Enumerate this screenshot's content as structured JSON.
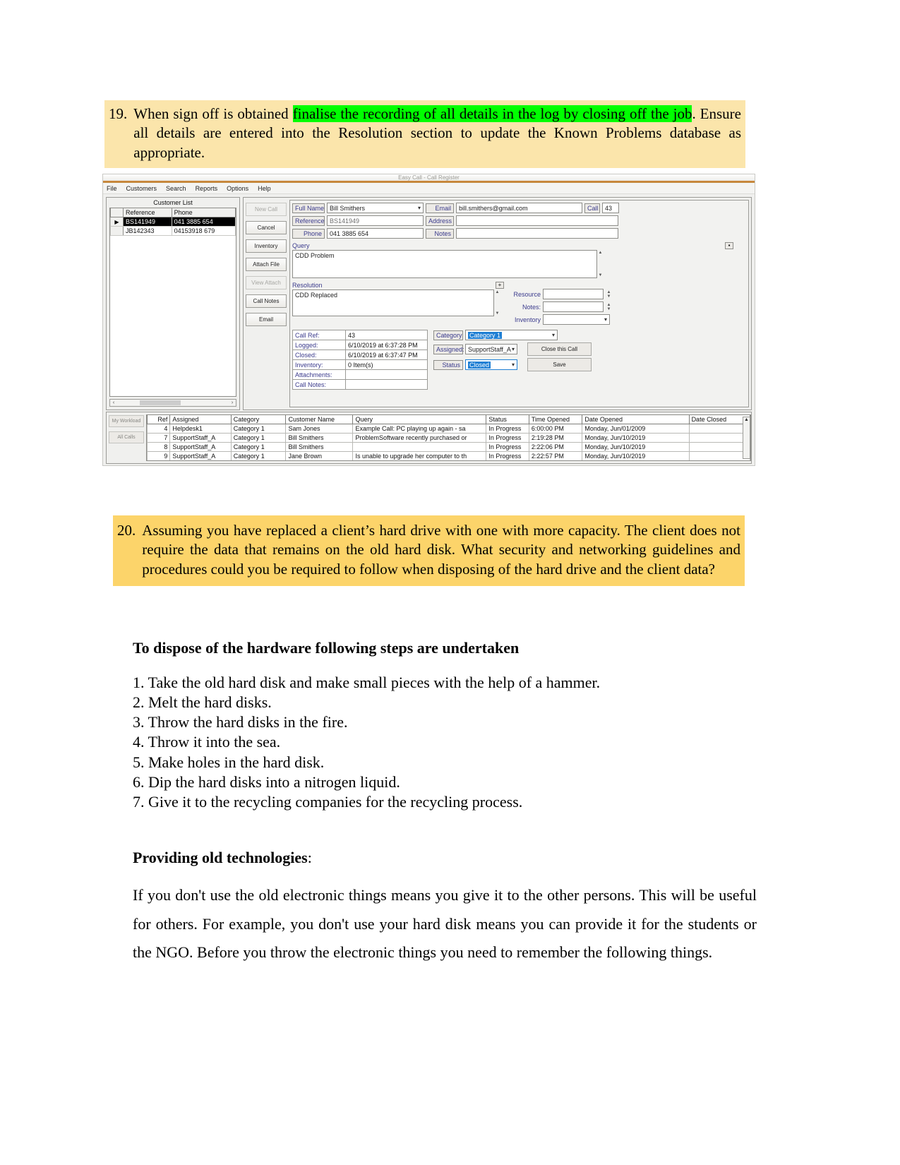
{
  "questions": [
    {
      "number": "19.",
      "text_before": "When sign off is obtained ",
      "highlight": "finalise the recording of all details in the log by closing off the job",
      "text_after": ". Ensure all details are entered into the Resolution section to update the Known Problems database as appropriate."
    },
    {
      "number": "20.",
      "text": "Assuming you have replaced a client’s hard drive with one with more capacity. The client does not require the data that remains on the old hard disk. What security and networking guidelines and procedures could you be required to follow when disposing of the hard drive and the client data?"
    }
  ],
  "app": {
    "title": "Easy Call - Call Register",
    "menu": [
      "File",
      "Customers",
      "Search",
      "Reports",
      "Options",
      "Help"
    ],
    "customer_panel": {
      "title": "Customer List",
      "columns": [
        "Reference",
        "Phone"
      ],
      "rows": [
        {
          "marker": "▶",
          "reference": "BS141949",
          "phone": "041 3885 654",
          "selected": true
        },
        {
          "marker": "",
          "reference": "JB142343",
          "phone": "04153918 679",
          "selected": false
        }
      ],
      "scroll_left": "‹",
      "scroll_right": "›"
    },
    "actions": [
      {
        "label": "New Call",
        "disabled": true
      },
      {
        "label": "Cancel",
        "disabled": false
      },
      {
        "label": "Inventory",
        "disabled": false
      },
      {
        "label": "Attach File",
        "disabled": false
      },
      {
        "label": "View Attach",
        "disabled": true
      },
      {
        "label": "Call Notes",
        "disabled": false
      },
      {
        "label": "Email",
        "disabled": false
      }
    ],
    "form": {
      "full_name_label": "Full Name",
      "full_name_value": "Bill Smithers",
      "reference_label": "Reference",
      "reference_value": "BS141949",
      "phone_label": "Phone",
      "phone_value": "041 3885 654",
      "email_label": "Email",
      "email_value": "bill.smithers@gmail.com",
      "address_label": "Address",
      "address_value": "",
      "notes_label": "Notes",
      "notes_value": "",
      "call_label": "Call",
      "call_value": "43",
      "query_label": "Query",
      "query_value": "CDD Problem",
      "resolution_label": "Resolution",
      "resolution_value": "CDD Replaced",
      "resource_label": "Resource",
      "resource_value": "",
      "res_notes_label": "Notes:",
      "res_notes_value": "",
      "inventory_label": "Inventory",
      "inventory_value": "",
      "plus_button": "+",
      "info_rows": [
        {
          "key": "Call Ref:",
          "value": "43"
        },
        {
          "key": "Logged:",
          "value": "6/10/2019  at  6:37:28 PM"
        },
        {
          "key": "Closed:",
          "value": "6/10/2019  at  6:37:47 PM"
        },
        {
          "key": "Inventory:",
          "value": "0 Item(s)"
        },
        {
          "key": "Attachments:",
          "value": ""
        },
        {
          "key": "Call Notes:",
          "value": ""
        }
      ],
      "category_label": "Category",
      "category_value": "Category 1",
      "assigned_label": "Assigned:",
      "assigned_value": "SupportStaff_A",
      "status_label": "Status",
      "status_value": "Closed",
      "close_call_button": "Close this Call",
      "save_button": "Save"
    },
    "workload": {
      "tabs": [
        "My Workload",
        "All Calls"
      ],
      "columns": [
        "Ref",
        "Assigned",
        "Category",
        "Customer Name",
        "Query",
        "Status",
        "Time Opened",
        "Date Opened",
        "Date Closed"
      ],
      "rows": [
        {
          "ref": "4",
          "assigned": "Helpdesk1",
          "category": "Category 1",
          "customer": "Sam Jones",
          "query": "Example Call: PC playing up again - sa",
          "status": "In Progress",
          "time_opened": "6:00:00 PM",
          "date_opened": "Monday, Jun/01/2009",
          "date_closed": ""
        },
        {
          "ref": "7",
          "assigned": "SupportStaff_A",
          "category": "Category 1",
          "customer": "Bill Smithers",
          "query": "ProblemSoftware recently purchased or",
          "status": "In Progress",
          "time_opened": "2:19:28 PM",
          "date_opened": "Monday, Jun/10/2019",
          "date_closed": ""
        },
        {
          "ref": "8",
          "assigned": "SupportStaff_A",
          "category": "Category 1",
          "customer": "Bill Smithers",
          "query": "",
          "status": "In Progress",
          "time_opened": "2:22:06 PM",
          "date_opened": "Monday, Jun/10/2019",
          "date_closed": ""
        },
        {
          "ref": "9",
          "assigned": "SupportStaff_A",
          "category": "Category 1",
          "customer": "Jane Brown",
          "query": "Is unable to upgrade her computer to th",
          "status": "In Progress",
          "time_opened": "2:22:57 PM",
          "date_opened": "Monday, Jun/10/2019",
          "date_closed": ""
        }
      ]
    }
  },
  "answer": {
    "heading": "To dispose of the hardware following steps are undertaken",
    "steps": [
      "1. Take the old hard disk and make small pieces with the help of a hammer.",
      "2. Melt the hard disks.",
      "3. Throw the hard disks in the fire.",
      "4. Throw it into the sea.",
      "5. Make holes in the hard disk.",
      "6. Dip the hard disks into a nitrogen liquid.",
      "7. Give it to the recycling companies for the recycling process."
    ],
    "subheading_bold": "Providing old technologies",
    "subheading_rest": ":",
    "paragraph": "If you don't use the old electronic things means you give it to the other persons. This will be useful for others. For example, you don't use your hard disk means you can provide it for the students or the NGO. Before you throw the electronic things you need to remember the following things."
  }
}
